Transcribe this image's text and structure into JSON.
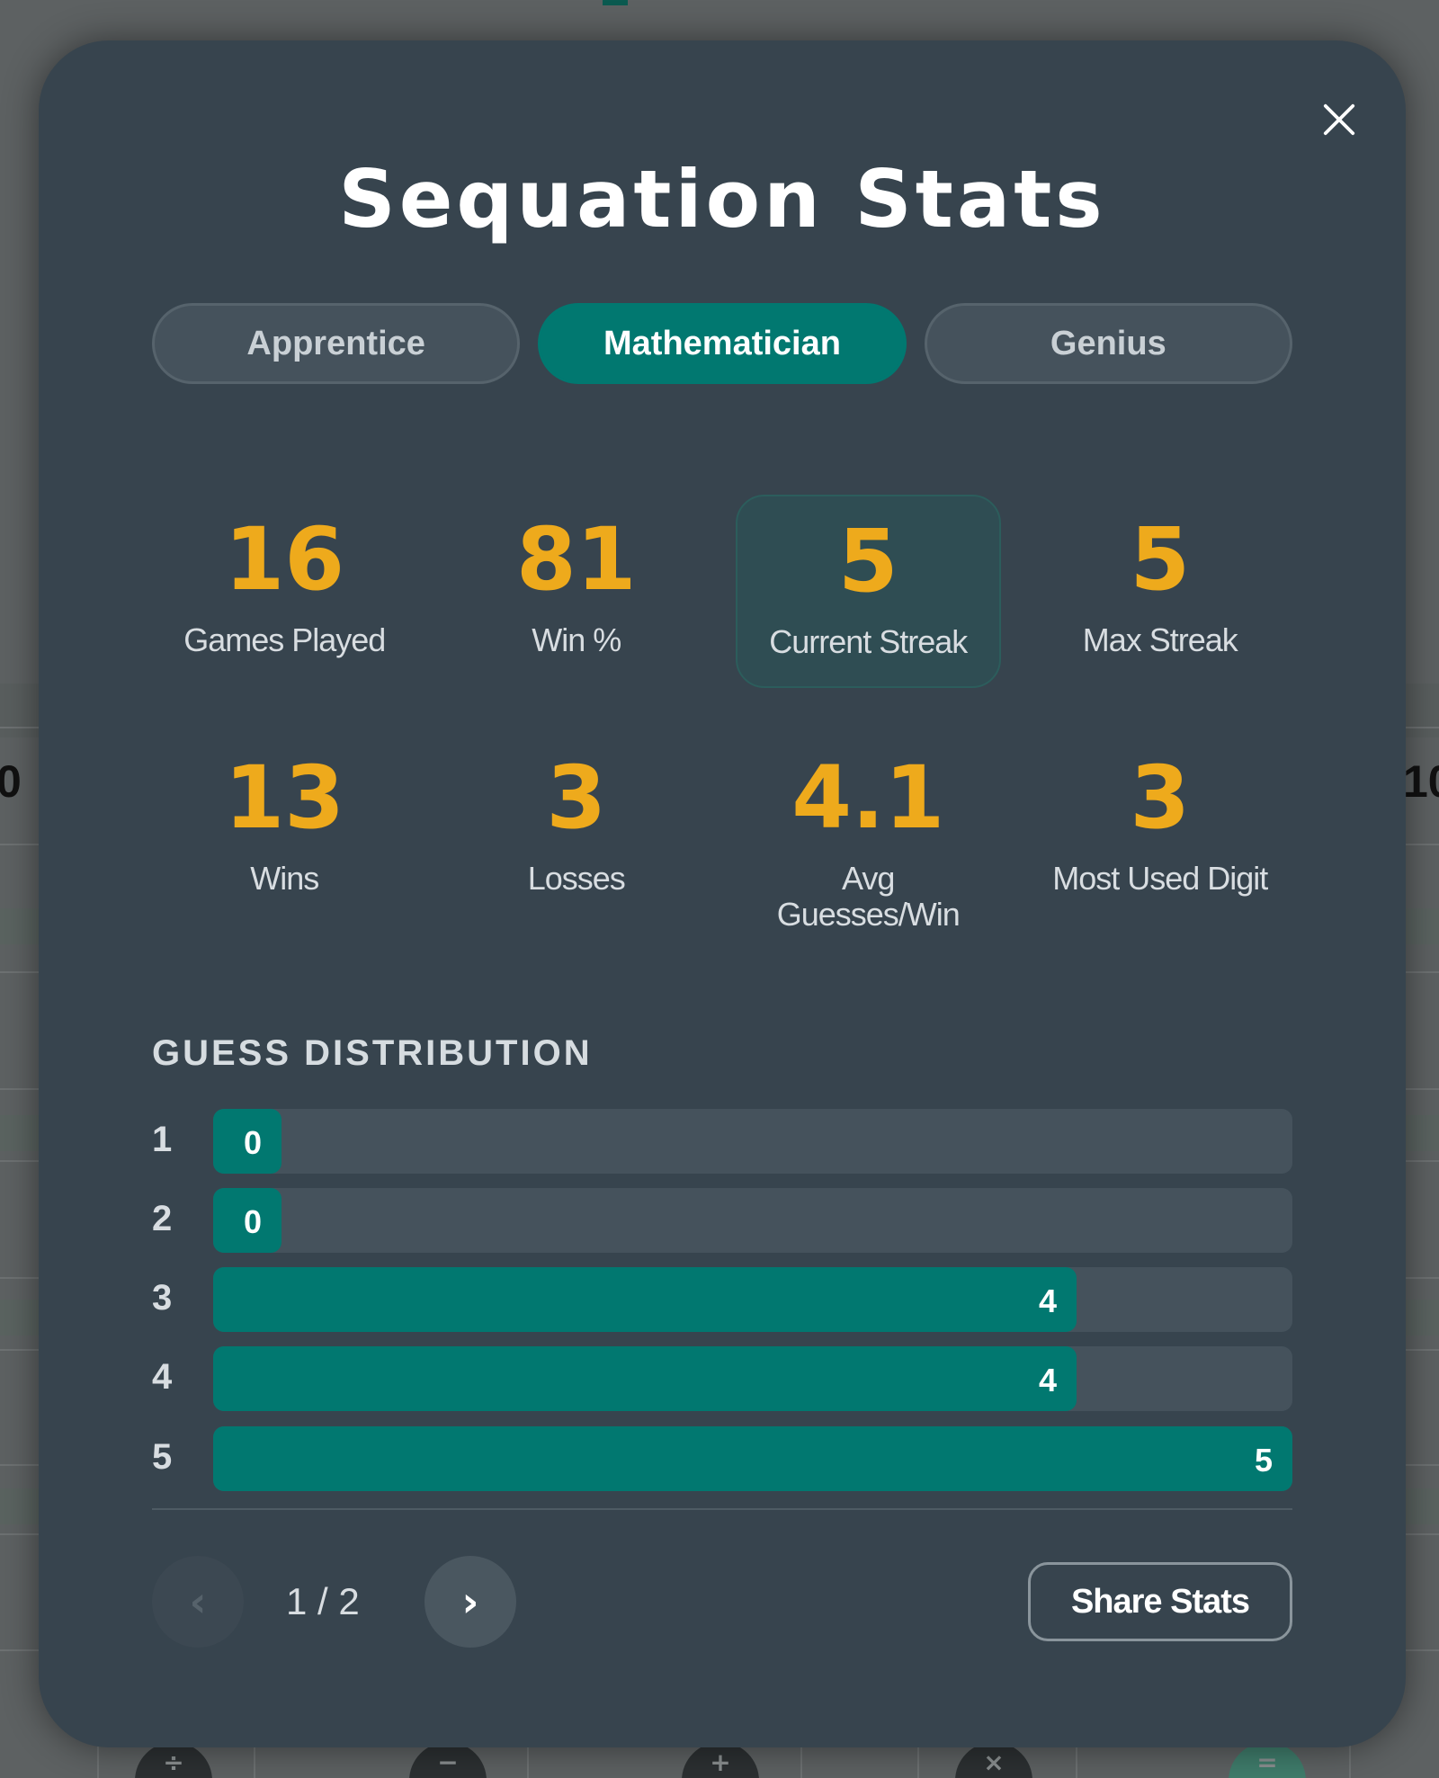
{
  "background": {
    "left_edge_number": "0",
    "right_edge_number": "10"
  },
  "modal": {
    "title": "Sequation Stats",
    "close_icon": "close-icon",
    "tabs": [
      {
        "label": "Apprentice",
        "active": false
      },
      {
        "label": "Mathematician",
        "active": true
      },
      {
        "label": "Genius",
        "active": false
      }
    ],
    "stats": [
      {
        "value": "16",
        "label": "Games Played",
        "highlight": false
      },
      {
        "value": "81",
        "label": "Win %",
        "highlight": false
      },
      {
        "value": "5",
        "label": "Current Streak",
        "highlight": true
      },
      {
        "value": "5",
        "label": "Max Streak",
        "highlight": false
      },
      {
        "value": "13",
        "label": "Wins",
        "highlight": false
      },
      {
        "value": "3",
        "label": "Losses",
        "highlight": false
      },
      {
        "value": "4.1",
        "label": "Avg Guesses/Win",
        "highlight": false
      },
      {
        "value": "3",
        "label": "Most Used Digit",
        "highlight": false
      }
    ],
    "distribution": {
      "title": "GUESS DISTRIBUTION",
      "rows": [
        {
          "guess": "1",
          "count": 0
        },
        {
          "guess": "2",
          "count": 0
        },
        {
          "guess": "3",
          "count": 4
        },
        {
          "guess": "4",
          "count": 4
        },
        {
          "guess": "5",
          "count": 5
        }
      ]
    },
    "pager": {
      "prev_label": "‹",
      "next_label": "›",
      "indicator": "1 / 2"
    },
    "share_label": "Share Stats"
  },
  "colors": {
    "accent": "#017870",
    "number": "#eeaa1c",
    "modal_bg": "#37444e"
  }
}
